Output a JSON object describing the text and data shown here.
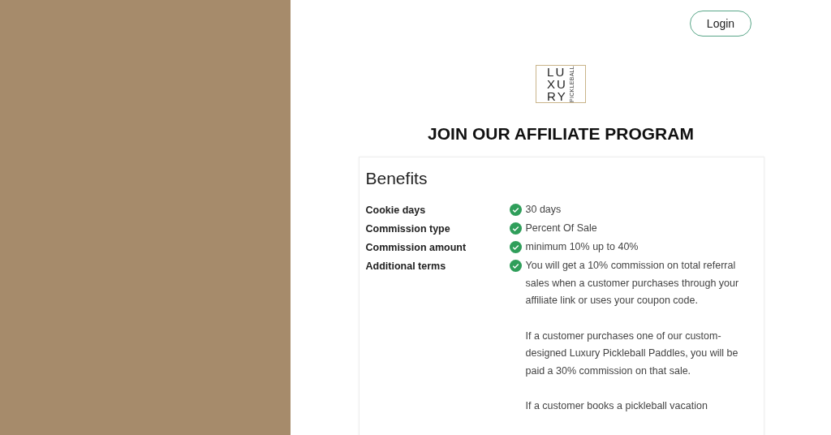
{
  "header": {
    "login_button": "Login"
  },
  "logo": {
    "lines": [
      "LU",
      "XU",
      "RY"
    ],
    "side_text": "PICKLEBALL"
  },
  "title": "JOIN OUR AFFILIATE PROGRAM",
  "benefits": {
    "heading": "Benefits",
    "rows": [
      {
        "label": "Cookie days",
        "paragraphs": [
          "30 days"
        ]
      },
      {
        "label": "Commission type",
        "paragraphs": [
          "Percent Of Sale"
        ]
      },
      {
        "label": "Commission amount",
        "paragraphs": [
          "minimum 10% up to 40%"
        ]
      },
      {
        "label": "Additional terms",
        "paragraphs": [
          "You will get a 10% commission on total referral sales when a customer purchases through your affiliate link or uses your coupon code.",
          "If a customer purchases one of our custom-designed Luxury Pickleball Paddles, you will be paid a 30% commission on that sale.",
          "If a customer books a pickleball vacation"
        ]
      }
    ]
  }
}
